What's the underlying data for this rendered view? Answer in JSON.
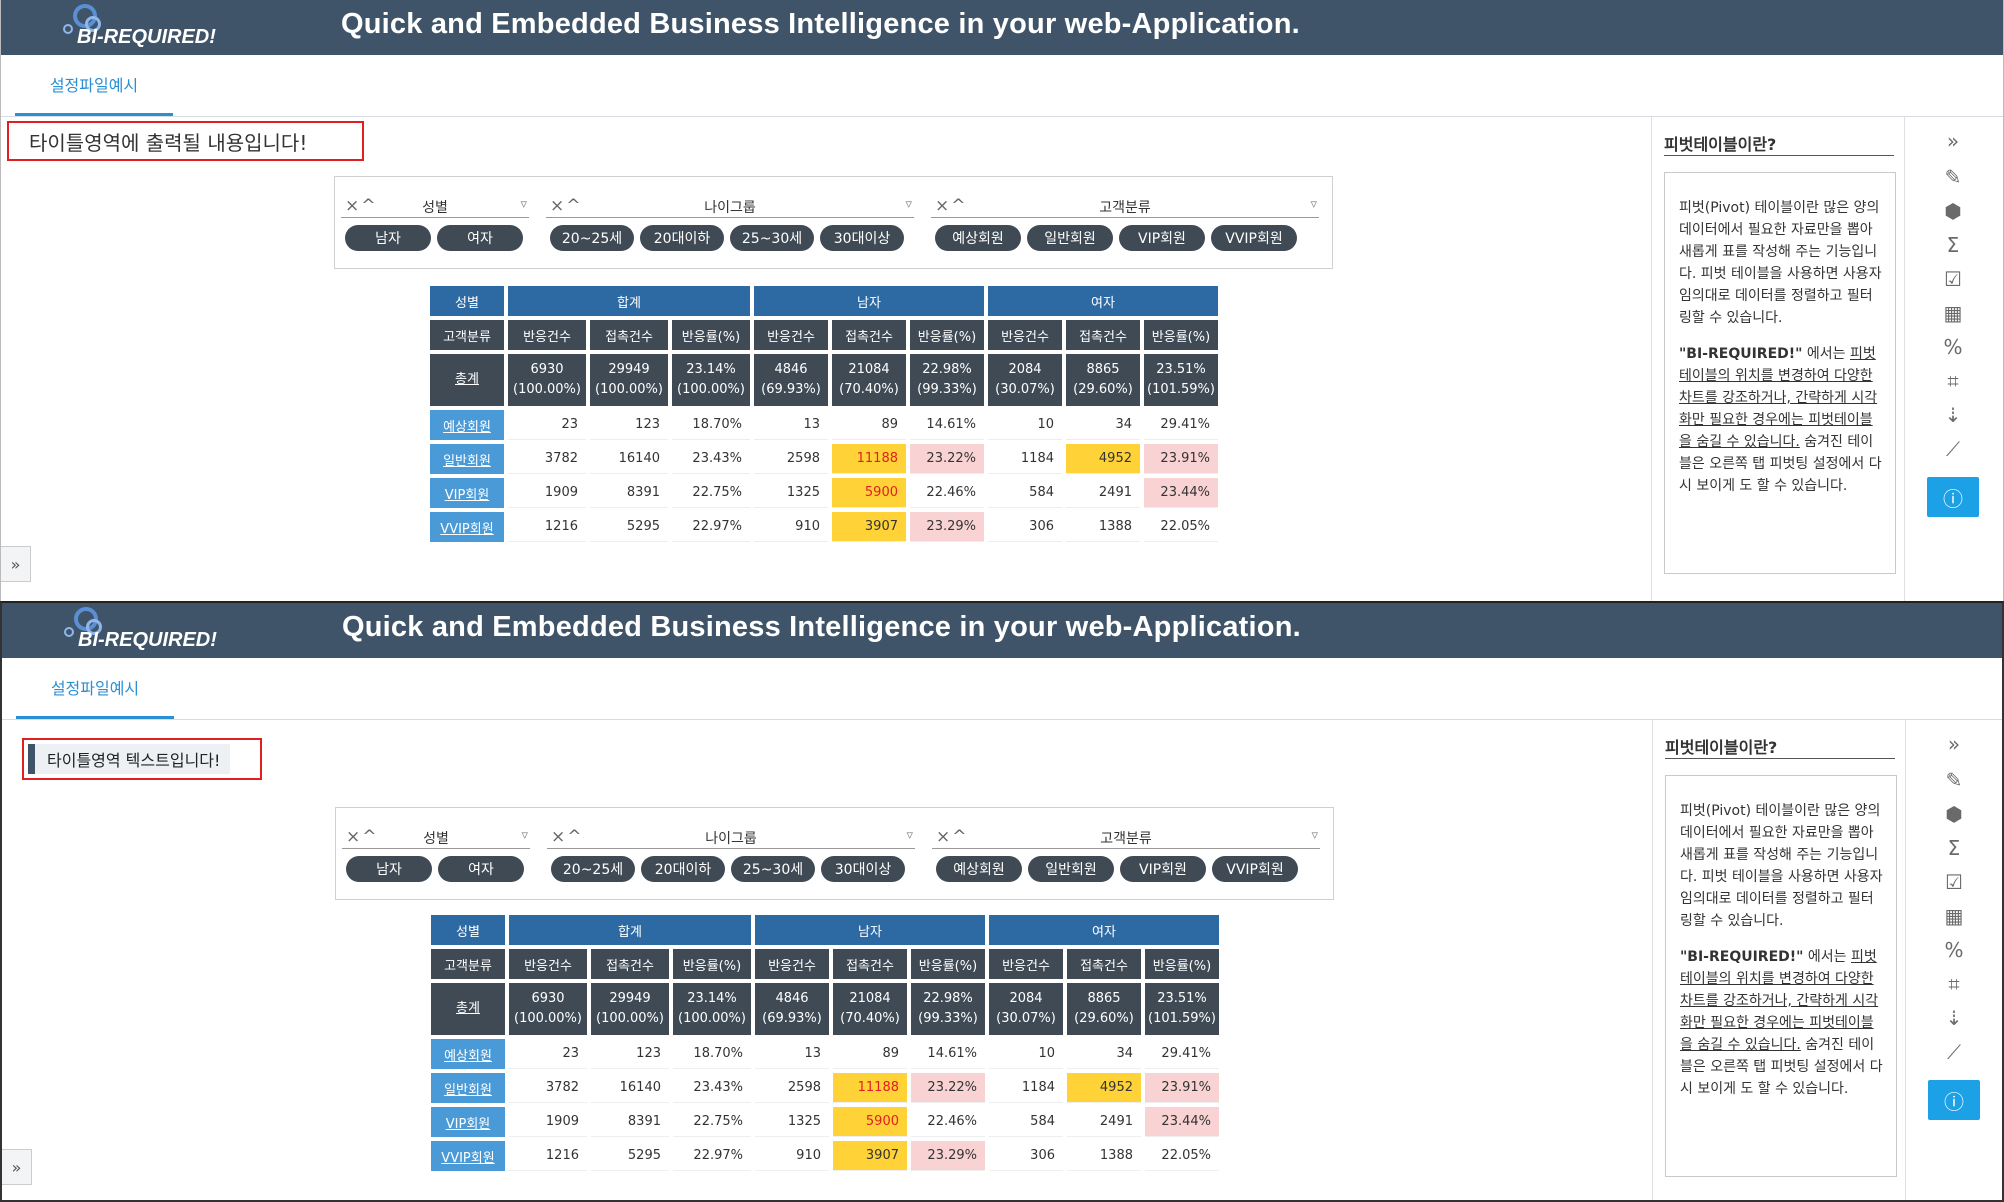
{
  "header": {
    "logo_text": "BI-REQUIRED!",
    "title": "Quick and Embedded Business Intelligence in your web-Application."
  },
  "tab": {
    "label": "설정파일예시"
  },
  "left_toggle": "»",
  "title_area_1": "타이틀영역에 출력될 내용입니다!",
  "title_area_2": "타이틀영역 텍스트입니다!",
  "filters": [
    {
      "name": "성별",
      "values": [
        "남자",
        "여자"
      ]
    },
    {
      "name": "나이그룹",
      "values": [
        "20~25세",
        "20대이하",
        "25~30세",
        "30대이상"
      ]
    },
    {
      "name": "고객분류",
      "values": [
        "예상회원",
        "일반회원",
        "VIP회원",
        "VVIP회원"
      ]
    }
  ],
  "filter_icons": {
    "remove": "×",
    "sort": "^",
    "funnel": "▿"
  },
  "pivot": {
    "corner_top": "성별",
    "corner_bottom": "고객분류",
    "groups": [
      "합계",
      "남자",
      "여자"
    ],
    "measures": [
      "반응건수",
      "접촉건수",
      "반응률(%)"
    ],
    "total_label": "총계",
    "total": [
      [
        "6930",
        "(100.00%)"
      ],
      [
        "29949",
        "(100.00%)"
      ],
      [
        "23.14%",
        "(100.00%)"
      ],
      [
        "4846",
        "(69.93%)"
      ],
      [
        "21084",
        "(70.40%)"
      ],
      [
        "22.98%",
        "(99.33%)"
      ],
      [
        "2084",
        "(30.07%)"
      ],
      [
        "8865",
        "(29.60%)"
      ],
      [
        "23.51%",
        "(101.59%)"
      ]
    ],
    "rows": [
      {
        "label": "예상회원",
        "cells": [
          "23",
          "123",
          "18.70%",
          "13",
          "89",
          "14.61%",
          "10",
          "34",
          "29.41%"
        ]
      },
      {
        "label": "일반회원",
        "cells": [
          "3782",
          "16140",
          "23.43%",
          "2598",
          "11188",
          "23.22%",
          "1184",
          "4952",
          "23.91%"
        ]
      },
      {
        "label": "VIP회원",
        "cells": [
          "1909",
          "8391",
          "22.75%",
          "1325",
          "5900",
          "22.46%",
          "584",
          "2491",
          "23.44%"
        ]
      },
      {
        "label": "VVIP회원",
        "cells": [
          "1216",
          "5295",
          "22.97%",
          "910",
          "3907",
          "23.29%",
          "306",
          "1388",
          "22.05%"
        ]
      }
    ]
  },
  "side": {
    "title": "피벗테이블이란?",
    "para1": "피벗(Pivot) 테이블이란 많은 양의 데이터에서 필요한 자료만을 뽑아 새롭게 표를 작성해 주는 기능입니다. 피벗 테이블을 사용하면 사용자 임의대로 데이터를 정렬하고 필터링할 수 있습니다.",
    "para2_bold": "\"BI-REQUIRED!\"",
    "para2_plain": " 에서는 ",
    "para2_underline": "피벗테이블의 위치를 변경하여 다양한 차트를 강조하거나, 간략하게 시각화만 필요한 경우에는 피벗테이블을 숨길 수 있습니다.",
    "para2_rest": " 숨겨진 테이블은 오른쪽 탭 피벗팅 설정에서 다시 보이게 도 할 수 있습니다."
  },
  "toolbar_icons": [
    {
      "name": "collapse-panel-icon",
      "glyph": "»"
    },
    {
      "name": "edit-icon",
      "glyph": "✎"
    },
    {
      "name": "cube-icon",
      "glyph": "⬢"
    },
    {
      "name": "sigma-icon",
      "glyph": "Σ"
    },
    {
      "name": "checklist-icon",
      "glyph": "☑"
    },
    {
      "name": "table-icon",
      "glyph": "▦"
    },
    {
      "name": "percent-icon",
      "glyph": "%"
    },
    {
      "name": "crop-icon",
      "glyph": "⌗"
    },
    {
      "name": "sort-desc-icon",
      "glyph": "⇣"
    },
    {
      "name": "line-chart-icon",
      "glyph": "⟋"
    },
    {
      "name": "info-icon",
      "glyph": "ⓘ"
    }
  ],
  "colors": {
    "header_bg": "#3f5468",
    "accent": "#2d8fd3",
    "table_header": "#2d6aa3",
    "highlight_yellow": "#ffd338",
    "highlight_pink": "#f9d3d3",
    "active_icon": "#1da1e6"
  }
}
